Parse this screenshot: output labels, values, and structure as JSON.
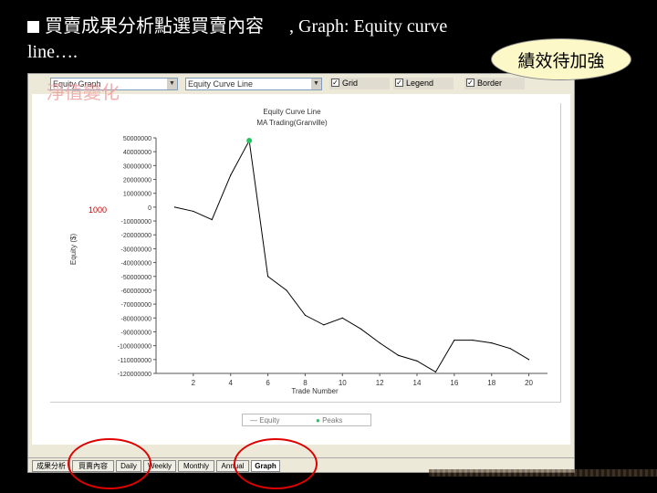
{
  "slide": {
    "title_line1_zh": "買賣成果分析點選買賣內容",
    "title_line1_en": ", Graph: Equity curve",
    "title_line2": "line….",
    "callout": "績效待加強",
    "overlay_label": "淨值變化"
  },
  "toolbar": {
    "chart_type_select": "Equity Graph",
    "curve_select": "Equity Curve Line",
    "checkboxes": [
      {
        "label": "Grid",
        "checked": true
      },
      {
        "label": "Legend",
        "checked": true
      },
      {
        "label": "Border",
        "checked": true
      }
    ]
  },
  "chart_data": {
    "type": "line",
    "title": "Equity Curve Line",
    "subtitle": "MA Trading(Granville)",
    "xlabel": "Trade Number",
    "ylabel": "Equity ($)",
    "x_ticks": [
      2,
      4,
      6,
      8,
      10,
      12,
      14,
      16,
      18,
      20
    ],
    "y_ticks": [
      50000000,
      40000000,
      30000000,
      20000000,
      10000000,
      0,
      -10000000,
      -20000000,
      -30000000,
      -40000000,
      -50000000,
      -60000000,
      -70000000,
      -80000000,
      -90000000,
      -100000000,
      -110000000,
      -120000000
    ],
    "y_tick_labels": [
      "50000000",
      "40000000",
      "30000000",
      "20000000",
      "10000000",
      "0",
      "-10000000",
      "-20000000",
      "-30000000",
      "-40000000",
      "-50000000",
      "-60000000",
      "-70000000",
      "-80000000",
      "-90000000",
      "-100000000",
      "-110000000",
      "-120000000"
    ],
    "xlim": [
      0,
      21
    ],
    "ylim": [
      -120000000,
      50000000
    ],
    "grid": false,
    "legend": "bottom",
    "series": [
      {
        "name": "Equity",
        "x": [
          1,
          2,
          3,
          4,
          5,
          6,
          7,
          8,
          9,
          10,
          11,
          12,
          13,
          14,
          15,
          16,
          17,
          18,
          19,
          20
        ],
        "y": [
          0,
          -3000000,
          -9000000,
          23000000,
          48000000,
          -50000000,
          -60000000,
          -78000000,
          -85000000,
          -80000000,
          -88000000,
          -98000000,
          -107000000,
          -111000000,
          -119000000,
          -96000000,
          -96000000,
          -98000000,
          -102000000,
          -110000000
        ]
      },
      {
        "name": "Peaks",
        "x": [
          5
        ],
        "y": [
          48000000
        ]
      }
    ],
    "annotation": "1000",
    "colors": {
      "line": "#000000",
      "peak": "#22c55e"
    }
  },
  "legend": {
    "equity_label": "Equity",
    "peaks_label": "Peaks"
  },
  "tabs": [
    "成果分析",
    "買賣內容",
    "Daily",
    "Weekly",
    "Monthly",
    "Annual",
    "Graph"
  ]
}
